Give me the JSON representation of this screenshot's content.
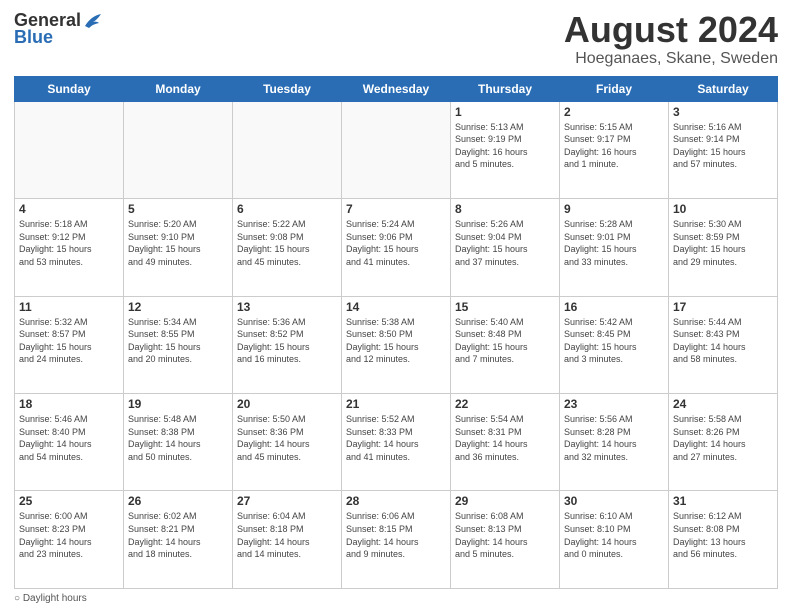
{
  "header": {
    "logo": {
      "general": "General",
      "blue": "Blue"
    },
    "title": "August 2024",
    "location": "Hoeganaes, Skane, Sweden"
  },
  "weekdays": [
    "Sunday",
    "Monday",
    "Tuesday",
    "Wednesday",
    "Thursday",
    "Friday",
    "Saturday"
  ],
  "legend": "Daylight hours",
  "weeks": [
    [
      {
        "day": "",
        "info": ""
      },
      {
        "day": "",
        "info": ""
      },
      {
        "day": "",
        "info": ""
      },
      {
        "day": "",
        "info": ""
      },
      {
        "day": "1",
        "info": "Sunrise: 5:13 AM\nSunset: 9:19 PM\nDaylight: 16 hours\nand 5 minutes."
      },
      {
        "day": "2",
        "info": "Sunrise: 5:15 AM\nSunset: 9:17 PM\nDaylight: 16 hours\nand 1 minute."
      },
      {
        "day": "3",
        "info": "Sunrise: 5:16 AM\nSunset: 9:14 PM\nDaylight: 15 hours\nand 57 minutes."
      }
    ],
    [
      {
        "day": "4",
        "info": "Sunrise: 5:18 AM\nSunset: 9:12 PM\nDaylight: 15 hours\nand 53 minutes."
      },
      {
        "day": "5",
        "info": "Sunrise: 5:20 AM\nSunset: 9:10 PM\nDaylight: 15 hours\nand 49 minutes."
      },
      {
        "day": "6",
        "info": "Sunrise: 5:22 AM\nSunset: 9:08 PM\nDaylight: 15 hours\nand 45 minutes."
      },
      {
        "day": "7",
        "info": "Sunrise: 5:24 AM\nSunset: 9:06 PM\nDaylight: 15 hours\nand 41 minutes."
      },
      {
        "day": "8",
        "info": "Sunrise: 5:26 AM\nSunset: 9:04 PM\nDaylight: 15 hours\nand 37 minutes."
      },
      {
        "day": "9",
        "info": "Sunrise: 5:28 AM\nSunset: 9:01 PM\nDaylight: 15 hours\nand 33 minutes."
      },
      {
        "day": "10",
        "info": "Sunrise: 5:30 AM\nSunset: 8:59 PM\nDaylight: 15 hours\nand 29 minutes."
      }
    ],
    [
      {
        "day": "11",
        "info": "Sunrise: 5:32 AM\nSunset: 8:57 PM\nDaylight: 15 hours\nand 24 minutes."
      },
      {
        "day": "12",
        "info": "Sunrise: 5:34 AM\nSunset: 8:55 PM\nDaylight: 15 hours\nand 20 minutes."
      },
      {
        "day": "13",
        "info": "Sunrise: 5:36 AM\nSunset: 8:52 PM\nDaylight: 15 hours\nand 16 minutes."
      },
      {
        "day": "14",
        "info": "Sunrise: 5:38 AM\nSunset: 8:50 PM\nDaylight: 15 hours\nand 12 minutes."
      },
      {
        "day": "15",
        "info": "Sunrise: 5:40 AM\nSunset: 8:48 PM\nDaylight: 15 hours\nand 7 minutes."
      },
      {
        "day": "16",
        "info": "Sunrise: 5:42 AM\nSunset: 8:45 PM\nDaylight: 15 hours\nand 3 minutes."
      },
      {
        "day": "17",
        "info": "Sunrise: 5:44 AM\nSunset: 8:43 PM\nDaylight: 14 hours\nand 58 minutes."
      }
    ],
    [
      {
        "day": "18",
        "info": "Sunrise: 5:46 AM\nSunset: 8:40 PM\nDaylight: 14 hours\nand 54 minutes."
      },
      {
        "day": "19",
        "info": "Sunrise: 5:48 AM\nSunset: 8:38 PM\nDaylight: 14 hours\nand 50 minutes."
      },
      {
        "day": "20",
        "info": "Sunrise: 5:50 AM\nSunset: 8:36 PM\nDaylight: 14 hours\nand 45 minutes."
      },
      {
        "day": "21",
        "info": "Sunrise: 5:52 AM\nSunset: 8:33 PM\nDaylight: 14 hours\nand 41 minutes."
      },
      {
        "day": "22",
        "info": "Sunrise: 5:54 AM\nSunset: 8:31 PM\nDaylight: 14 hours\nand 36 minutes."
      },
      {
        "day": "23",
        "info": "Sunrise: 5:56 AM\nSunset: 8:28 PM\nDaylight: 14 hours\nand 32 minutes."
      },
      {
        "day": "24",
        "info": "Sunrise: 5:58 AM\nSunset: 8:26 PM\nDaylight: 14 hours\nand 27 minutes."
      }
    ],
    [
      {
        "day": "25",
        "info": "Sunrise: 6:00 AM\nSunset: 8:23 PM\nDaylight: 14 hours\nand 23 minutes."
      },
      {
        "day": "26",
        "info": "Sunrise: 6:02 AM\nSunset: 8:21 PM\nDaylight: 14 hours\nand 18 minutes."
      },
      {
        "day": "27",
        "info": "Sunrise: 6:04 AM\nSunset: 8:18 PM\nDaylight: 14 hours\nand 14 minutes."
      },
      {
        "day": "28",
        "info": "Sunrise: 6:06 AM\nSunset: 8:15 PM\nDaylight: 14 hours\nand 9 minutes."
      },
      {
        "day": "29",
        "info": "Sunrise: 6:08 AM\nSunset: 8:13 PM\nDaylight: 14 hours\nand 5 minutes."
      },
      {
        "day": "30",
        "info": "Sunrise: 6:10 AM\nSunset: 8:10 PM\nDaylight: 14 hours\nand 0 minutes."
      },
      {
        "day": "31",
        "info": "Sunrise: 6:12 AM\nSunset: 8:08 PM\nDaylight: 13 hours\nand 56 minutes."
      }
    ]
  ]
}
